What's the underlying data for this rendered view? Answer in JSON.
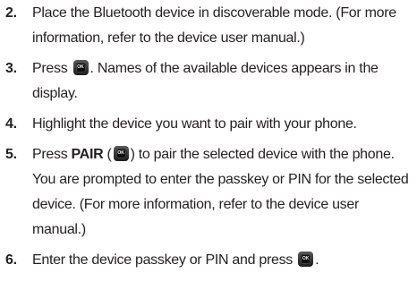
{
  "steps": [
    {
      "number": "2.",
      "text": "Place the Bluetooth device in discoverable mode. (For more information, refer to the device user manual.)"
    },
    {
      "number": "3.",
      "text_before": "Press ",
      "text_after": ". Names of the available devices appears in the display."
    },
    {
      "number": "4.",
      "text": "Highlight the device you want to pair with your phone."
    },
    {
      "number": "5.",
      "text_before": "Press ",
      "bold": "PAIR",
      "paren_open": " (",
      "text_after": ") to pair the selected device with the phone. You are prompted to enter the passkey or PIN for the selected device. (For more information, refer to the device user manual.)"
    },
    {
      "number": "6.",
      "text_before": "Enter the device passkey or PIN and press ",
      "text_after": "."
    }
  ],
  "key_icon": {
    "name": "ok-key-icon",
    "label": "OK"
  }
}
